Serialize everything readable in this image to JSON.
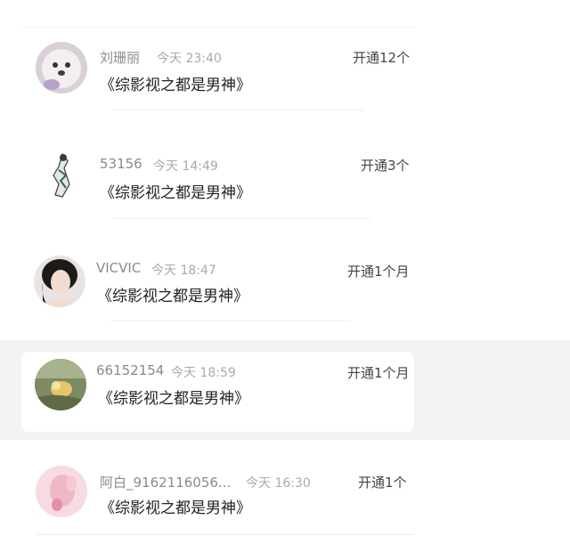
{
  "messages": [
    {
      "user": "刘珊丽",
      "time": "今天 23:40",
      "title": "《综影视之都是男神》",
      "action": "开通12个"
    },
    {
      "user": "53156",
      "time": "今天 14:49",
      "title": "《综影视之都是男神》",
      "action": "开通3个"
    },
    {
      "user": "VICVIC",
      "time": "今天 18:47",
      "title": "《综影视之都是男神》",
      "action": "开通1个月"
    },
    {
      "user": "66152154",
      "time": "今天 18:59",
      "title": "《综影视之都是男神》",
      "action": "开通1个月"
    },
    {
      "user": "阿白_9162116056...",
      "time": "今天 16:30",
      "title": "《综影视之都是男神》",
      "action": "开通1个"
    }
  ],
  "colors": {
    "background": "#ffffff",
    "highlight_band": "#f2f2f2",
    "title_text": "#222222",
    "meta_text": "#aaaaaa"
  },
  "avatars": [
    "fluffy-dog-avatar",
    "sketch-figure-avatar",
    "woman-portrait-avatar",
    "bird-photo-avatar",
    "pink-flower-avatar"
  ]
}
